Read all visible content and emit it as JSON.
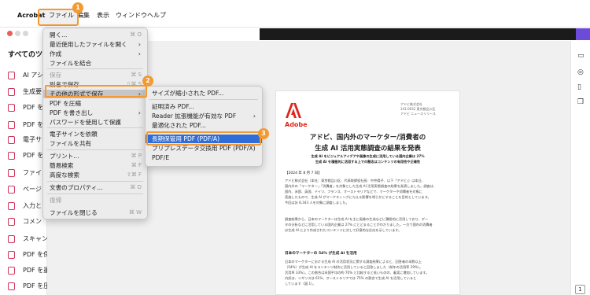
{
  "menubar": {
    "app": "Acrobat",
    "items": [
      "ファイル",
      "編集",
      "表示",
      "ウィンドウ",
      "ヘルプ"
    ]
  },
  "sidebar": {
    "title": "すべてのツ",
    "items": [
      "AI アシ",
      "生成要",
      "PDF を",
      "PDF を",
      "電子サ",
      "PDF を",
      "ファイ",
      "ページ",
      "入力と",
      "コメン",
      "スキャンと OCR",
      "PDF を保護",
      "PDF を墨消し",
      "PDF を圧縮"
    ]
  },
  "file_menu": {
    "items": [
      {
        "label": "開く...",
        "shortcut": "⌘ O"
      },
      {
        "label": "最近使用したファイルを開く",
        "submenu": true
      },
      {
        "label": "作成",
        "submenu": true
      },
      {
        "label": "ファイルを結合"
      },
      {
        "label": "保存",
        "shortcut": "⌘ S",
        "disabled": true
      },
      {
        "label": "別名で保存...",
        "shortcut": "⇧⌘ S"
      },
      {
        "label": "その他の形式で保存",
        "submenu": true
      },
      {
        "label": "PDF を圧縮"
      },
      {
        "label": "PDF を書き出し",
        "submenu": true
      },
      {
        "label": "パスワードを使用して保護"
      },
      {
        "label": "電子サインを依頼"
      },
      {
        "label": "ファイルを共有"
      },
      {
        "label": "プリント...",
        "shortcut": "⌘ P"
      },
      {
        "label": "簡易検索",
        "shortcut": "⌘ F"
      },
      {
        "label": "高度な検索",
        "shortcut": "⇧⌘ F"
      },
      {
        "label": "文書のプロパティ...",
        "shortcut": "⌘ D"
      },
      {
        "label": "復帰",
        "disabled": true
      },
      {
        "label": "ファイルを閉じる",
        "shortcut": "⌘ W"
      }
    ]
  },
  "save_as_menu": {
    "items": [
      {
        "label": "サイズが縮小された PDF..."
      },
      {
        "label": "証明済み PDF..."
      },
      {
        "label": "Reader 拡張機能が有効な PDF",
        "submenu": true
      },
      {
        "label": "最適化された PDF..."
      },
      {
        "label": "長期保管用 PDF (PDF/A)"
      },
      {
        "label": "プリプレスデータ交換用 PDF (PDF/X)"
      },
      {
        "label": "PDF/E"
      }
    ]
  },
  "callouts": [
    "1",
    "2",
    "3"
  ],
  "document": {
    "logo_text": "Adobe",
    "header_right": [
      "アドビ株式会社",
      "141-0032 東京都品川区",
      "アドビ ニュースリリース"
    ],
    "title_line1": "アドビ、国内外のマーケター/消費者の",
    "title_line2": "生成 AI 活用実態調査の結果を発表",
    "subtitle1": "生成 AI をビジュアルアイデアや画像の生成に活用している国内企業は 27%",
    "subtitle2": "生成 AI を積極的に活用する上での懸念はコンテンツの有用性や正確性",
    "date": "【2024 年 8 月 7 日】",
    "body1": [
      "アドビ株式会社（本社：東京都品川区、代表取締役社長：中井陽子、以下「アドビ」）は本日、",
      "国内外の「マーケター」「消費者」を対象とした生成 AI 活用実態調査の結果を発表しました。調査は、",
      "国内、米国、英国、ドイツ、フランス、オーストラリアなどで、マーケターや消費者を対象に",
      "実施したもので、生成 AI がマーケティングに与える影響を明らかにすることを目的としています。",
      "今回は計 8,343 人を対象に調査しました。"
    ],
    "body2": [
      "調査結果から、日本のマーケターは生成 AI を主に画像の生成などに積極的に活用しており、デー",
      "タの分析などに活用している国内企業は 27% にとどまることがわかりました。一方で国内の消費者",
      "は生成 AI により作成されたコンテンツに対して好意的な反応を示しています。"
    ],
    "section": "日本のマーケターの 54% が生成 AI を活用",
    "body3": [
      "日本のマーケターにおける生成 AI の活用状況に関する調査結果によると、回答者の半数以上",
      "（54%）が生成 AI をコンテンツ制作に活用していると回答しました（前年の活用率 29%）。",
      "活用率 33%）。この割合は米国平均の約 70% と比較すると低いものの、着実に増加しています。",
      "内訳は、イギリスは 61%、オーストラリアでは 75% の割合で生成 AI を活用していると",
      "しています（図 1）。"
    ]
  },
  "page_indicator": "1"
}
